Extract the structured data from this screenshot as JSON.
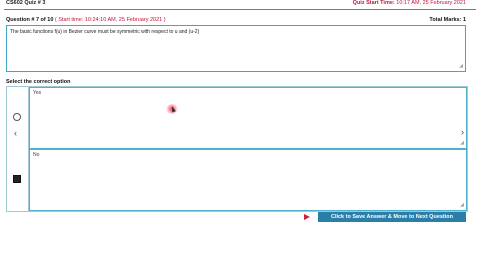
{
  "header": {
    "quiz_title": "CS602 Quiz # 3",
    "quiz_start_label": "Quiz Start Time:",
    "quiz_start_value": "10:17 AM, 25 February 2021"
  },
  "question": {
    "number_label": "Question # 7 of 10",
    "start_time_label": "( Start time: 10:24:10 AM, 25 February 2021 )",
    "total_marks_label": "Total Marks: 1",
    "text": "The basic functions f(u) in Bezier curve must be symmetric with respect to u and (u-2)"
  },
  "options": {
    "select_label": "Select the correct option",
    "items": [
      {
        "text": "Yes",
        "selected": false
      },
      {
        "text": "No",
        "selected": true
      }
    ]
  },
  "actions": {
    "submit_label": "Click to Save Answer & Move to Next Question"
  },
  "colors": {
    "accent": "#2a7fa8",
    "alert_red": "#c0143c",
    "border_blue": "#3fa6c9"
  },
  "icons": {
    "prev": "chevron-left-icon",
    "next": "chevron-right-icon",
    "submit": "red-triangle-icon"
  }
}
